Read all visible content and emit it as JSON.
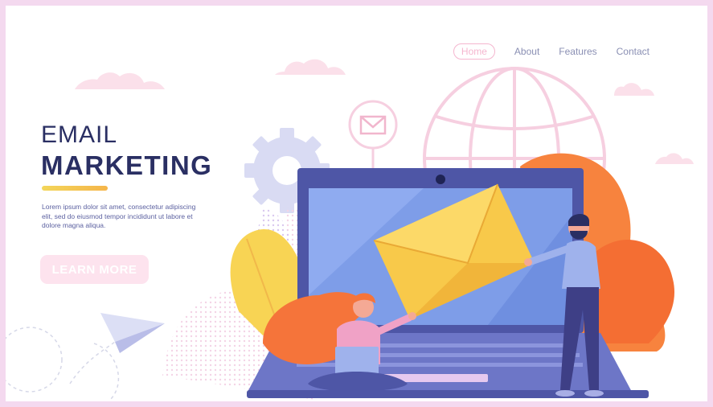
{
  "nav": {
    "home": "Home",
    "about": "About",
    "features": "Features",
    "contact": "Contact"
  },
  "hero": {
    "title_line1": "EMAIL",
    "title_line2": "MARKETING",
    "body": "Lorem ipsum dolor sit amet, consectetur adipiscing elit, sed do eiusmod tempor incididunt ut labore et dolore magna aliqua.",
    "cta_label": "LEARN MORE"
  },
  "colors": {
    "frame": "#f4d9ef",
    "title": "#2a2f63",
    "accent_yellow": "#f5c84a",
    "accent_orange": "#f57a3b",
    "laptop_blue": "#4e56a6",
    "screen_blue": "#7e9de8",
    "envelope": "#f8c94a",
    "nav_active": "#f5b6cf",
    "cta_bg": "#fde3ee"
  },
  "icons": [
    "cloud-icon",
    "globe-icon",
    "mail-pin-icon",
    "gear-icon",
    "paper-plane-icon",
    "envelope-icon",
    "leaf-icon"
  ]
}
